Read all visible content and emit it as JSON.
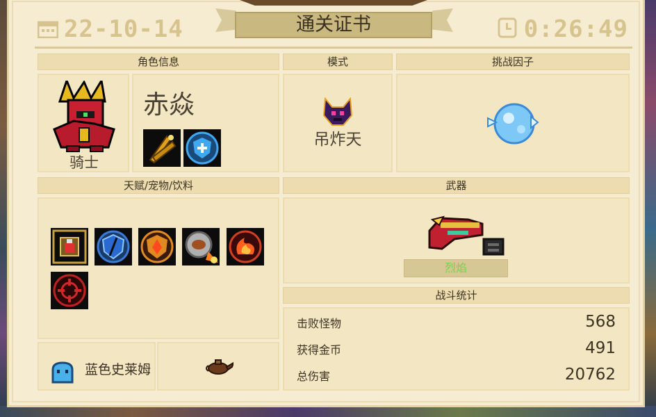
{
  "header": {
    "date": "22-10-14",
    "title": "通关证书",
    "time": "0:26:49"
  },
  "sections": {
    "character": "角色信息",
    "mode": "模式",
    "challenge": "挑战因子",
    "talents": "天赋/宠物/饮料",
    "weapon": "武器",
    "stats": "战斗统计"
  },
  "character": {
    "name": "赤焱",
    "class": "骑士",
    "skills": [
      "crossed-blades-icon",
      "shield-buff-icon"
    ]
  },
  "mode": {
    "name": "吊炸天",
    "icon": "demon-horns-icon"
  },
  "challenge": {
    "icon": "ice-orb-icon"
  },
  "talents": [
    {
      "icon": "potion-talent-icon",
      "border": "#c8a040"
    },
    {
      "icon": "shield-split-talent-icon",
      "border": "#3a7ad8"
    },
    {
      "icon": "fire-shield-talent-icon",
      "border": "#e08a20"
    },
    {
      "icon": "fireball-orb-talent-icon",
      "border": "#444444"
    },
    {
      "icon": "flame-swirl-talent-icon",
      "border": "#d04020"
    },
    {
      "icon": "crosshair-talent-icon",
      "border": "#c02020"
    }
  ],
  "pet": {
    "name": "蓝色史莱姆",
    "icon": "blue-slime-icon"
  },
  "drink": {
    "icon": "magic-lamp-icon"
  },
  "weapon": {
    "name": "烈焰",
    "icon": "flame-gun-icon",
    "name_color": "#7bd24a"
  },
  "stats": [
    {
      "label": "击败怪物",
      "value": "568"
    },
    {
      "label": "获得金币",
      "value": "491"
    },
    {
      "label": "总伤害",
      "value": "20762"
    }
  ]
}
